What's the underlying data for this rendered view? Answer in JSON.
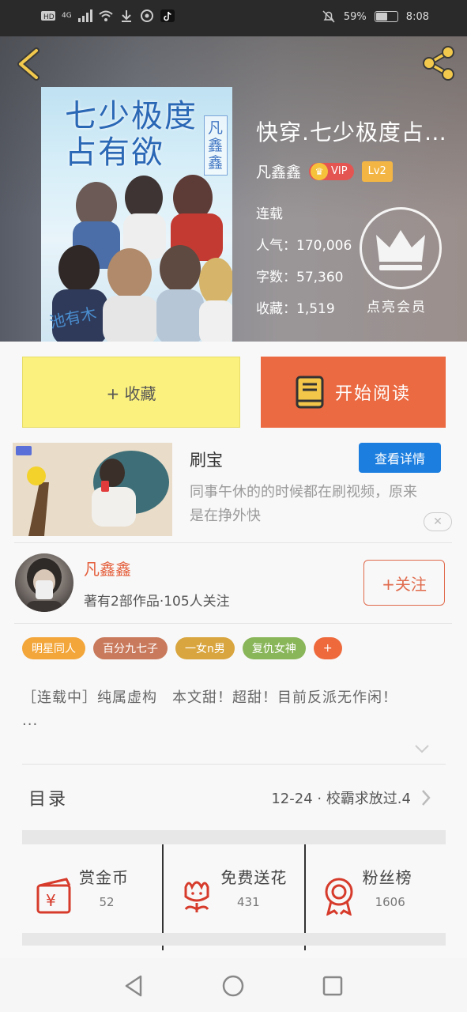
{
  "status_bar": {
    "network": "4G",
    "battery_text": "59%",
    "battery_level": 0.59,
    "time": "8:08"
  },
  "header": {
    "back_icon": "chevron-left-icon",
    "share_icon": "share-icon",
    "cover": {
      "title": "七少极度占有欲",
      "author": "凡鑫鑫",
      "signature": "池有木"
    },
    "book_title": "快穿.七少极度占…",
    "author": "凡鑫鑫",
    "vip_label": "VIP",
    "level_label": "Lv2",
    "status": "连载",
    "popularity_label": "人气：",
    "popularity_value": "170,006",
    "words_label": "字数：",
    "words_value": "57,360",
    "favorites_label": "收藏：",
    "favorites_value": "1,519",
    "member_label": "点亮会员"
  },
  "actions": {
    "collect_label": "+ 收藏",
    "read_label": "开始阅读"
  },
  "ad": {
    "title": "刷宝",
    "detail_label": "查看详情",
    "description": "同事午休的的时候都在刷视频，原来是在挣外快"
  },
  "author_card": {
    "name": "凡鑫鑫",
    "stats": "著有2部作品·105人关注",
    "follow_label": "+关注"
  },
  "tags": [
    {
      "label": "明星同人",
      "color": "#f3a63a"
    },
    {
      "label": "百分九七子",
      "color": "#c97a5c"
    },
    {
      "label": "一女n男",
      "color": "#d9a53e"
    },
    {
      "label": "复仇女神",
      "color": "#8ab65a"
    },
    {
      "label": "+",
      "color": "#ee6a3c"
    }
  ],
  "summary": "［连载中］纯属虚构　本文甜！超甜！目前反派无作闲！　　　　　　···",
  "toc": {
    "label": "目录",
    "latest": "12-24 · 校霸求放过.4"
  },
  "rewards": [
    {
      "label": "赏金币",
      "value": "52",
      "icon": "gift-coin-icon"
    },
    {
      "label": "免费送花",
      "value": "431",
      "icon": "flower-icon"
    },
    {
      "label": "粉丝榜",
      "value": "1606",
      "icon": "medal-icon"
    }
  ],
  "nav": {
    "back": "back-triangle-icon",
    "home": "home-circle-icon",
    "recents": "recents-square-icon"
  }
}
